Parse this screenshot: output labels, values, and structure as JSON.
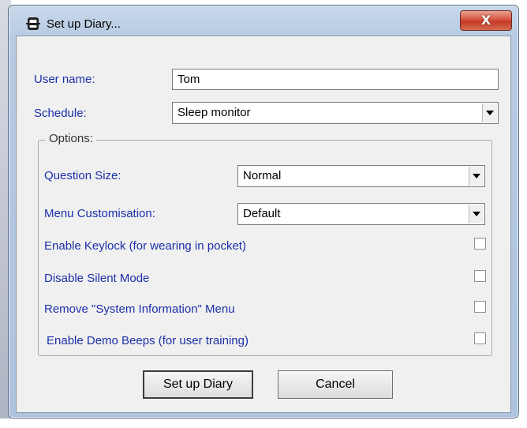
{
  "window": {
    "title": "Set up Diary...",
    "close_glyph": "X"
  },
  "form": {
    "user_name_label": "User name:",
    "user_name_value": "Tom",
    "schedule_label": "Schedule:",
    "schedule_value": "Sleep monitor"
  },
  "options": {
    "group_label": "Options:",
    "question_size_label": "Question Size:",
    "question_size_value": "Normal",
    "menu_customisation_label": "Menu Customisation:",
    "menu_customisation_value": "Default",
    "checkboxes": [
      {
        "label": "Enable Keylock (for wearing in pocket)",
        "checked": false
      },
      {
        "label": "Disable Silent Mode",
        "checked": false
      },
      {
        "label": "Remove \"System Information\" Menu",
        "checked": false
      },
      {
        "label": "Enable Demo Beeps (for user training)",
        "checked": false
      }
    ]
  },
  "buttons": {
    "setup_label": "Set up Diary",
    "cancel_label": "Cancel"
  },
  "icons": {
    "title_icon": "diary-device-icon",
    "close_icon": "close-icon",
    "dropdown_icon": "chevron-down-icon"
  },
  "colors": {
    "label_blue": "#1c2fa8",
    "close_red": "#c13a25"
  }
}
